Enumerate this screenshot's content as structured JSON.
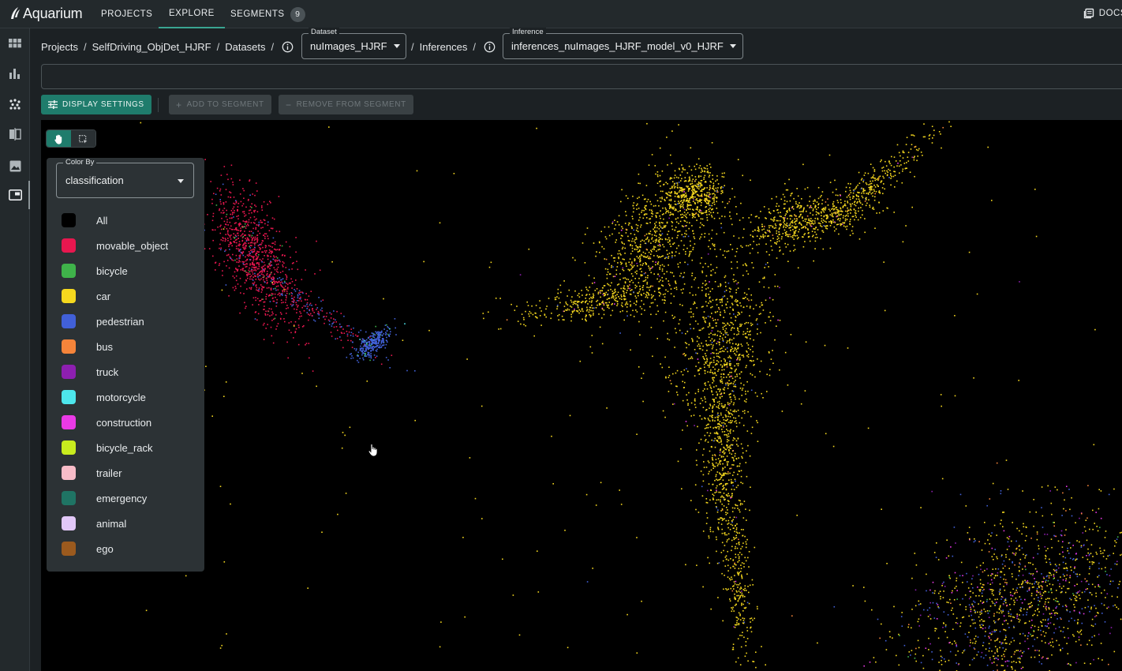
{
  "app": {
    "name": "Aquarium"
  },
  "nav": {
    "projects": "PROJECTS",
    "explore": "EXPLORE",
    "segments": "SEGMENTS",
    "segments_count": "9",
    "docs": "DOCS"
  },
  "sidebar": {
    "icons": [
      "grid-icon",
      "bar-chart-icon",
      "scatter-icon",
      "compare-icon",
      "image-icon",
      "embedding-view-icon"
    ],
    "active_index": 5
  },
  "breadcrumb": {
    "projects": "Projects",
    "project": "SelfDriving_ObjDet_HJRF",
    "datasets": "Datasets",
    "inferences": "Inferences",
    "sep": "/"
  },
  "dataset_select": {
    "label": "Dataset",
    "value": "nuImages_HJRF"
  },
  "inference_select": {
    "label": "Inference",
    "value": "inferences_nuImages_HJRF_model_v0_HJRF"
  },
  "search": {
    "value": ""
  },
  "toolbar": {
    "display_settings": "DISPLAY SETTINGS",
    "add_to_segment": "ADD TO SEGMENT",
    "remove_from_segment": "REMOVE FROM SEGMENT"
  },
  "tools": {
    "pan": "hand-icon",
    "select": "lasso-select-icon",
    "active": "pan"
  },
  "color_by": {
    "label": "Color By",
    "value": "classification",
    "items": [
      {
        "label": "All",
        "color": "#000000"
      },
      {
        "label": "movable_object",
        "color": "#e8174f"
      },
      {
        "label": "bicycle",
        "color": "#3fb34a"
      },
      {
        "label": "car",
        "color": "#f5d81e"
      },
      {
        "label": "pedestrian",
        "color": "#4160d8"
      },
      {
        "label": "bus",
        "color": "#f5843a"
      },
      {
        "label": "truck",
        "color": "#8d1fb0"
      },
      {
        "label": "motorcycle",
        "color": "#4de6ec"
      },
      {
        "label": "construction",
        "color": "#ea3ae6"
      },
      {
        "label": "bicycle_rack",
        "color": "#c8ec1e"
      },
      {
        "label": "trailer",
        "color": "#f8bcc8"
      },
      {
        "label": "emergency",
        "color": "#1f7464"
      },
      {
        "label": "animal",
        "color": "#e2c8f8"
      },
      {
        "label": "ego",
        "color": "#9b5a1e"
      }
    ]
  }
}
